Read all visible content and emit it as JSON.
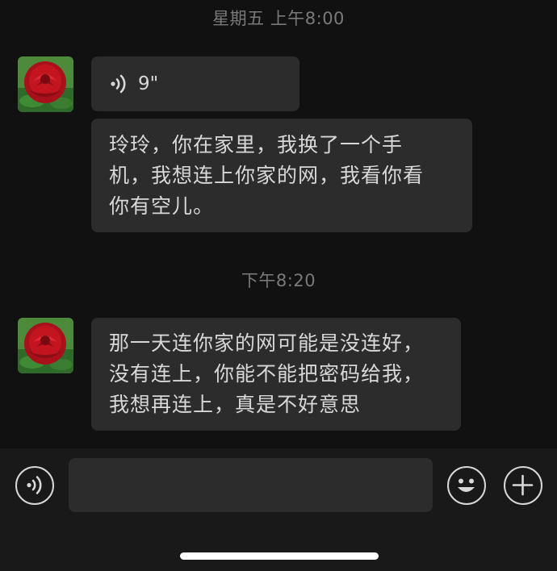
{
  "messages": [
    {
      "timestamp": "星期五 上午8:00",
      "voice": {
        "duration": "9\""
      },
      "text_lines": [
        "玲玲，你在家里，我换了一个手",
        "机，我想连上你家的网，我看你看",
        "你有空儿。"
      ]
    },
    {
      "timestamp": "下午8:20",
      "text_lines": [
        "那一天连你家的网可能是没连好，",
        "没有连上，你能不能把密码给我，",
        "我想再连上，真是不好意思"
      ]
    }
  ],
  "input_bar": {
    "message_value": "",
    "icons": [
      "voice-icon",
      "emoji-icon",
      "plus-icon"
    ]
  },
  "colors": {
    "background": "#111111",
    "bubble": "#2c2c2c",
    "input_bar": "#191919",
    "timestamp": "#7a7a7a",
    "text": "#d8d8d8"
  }
}
